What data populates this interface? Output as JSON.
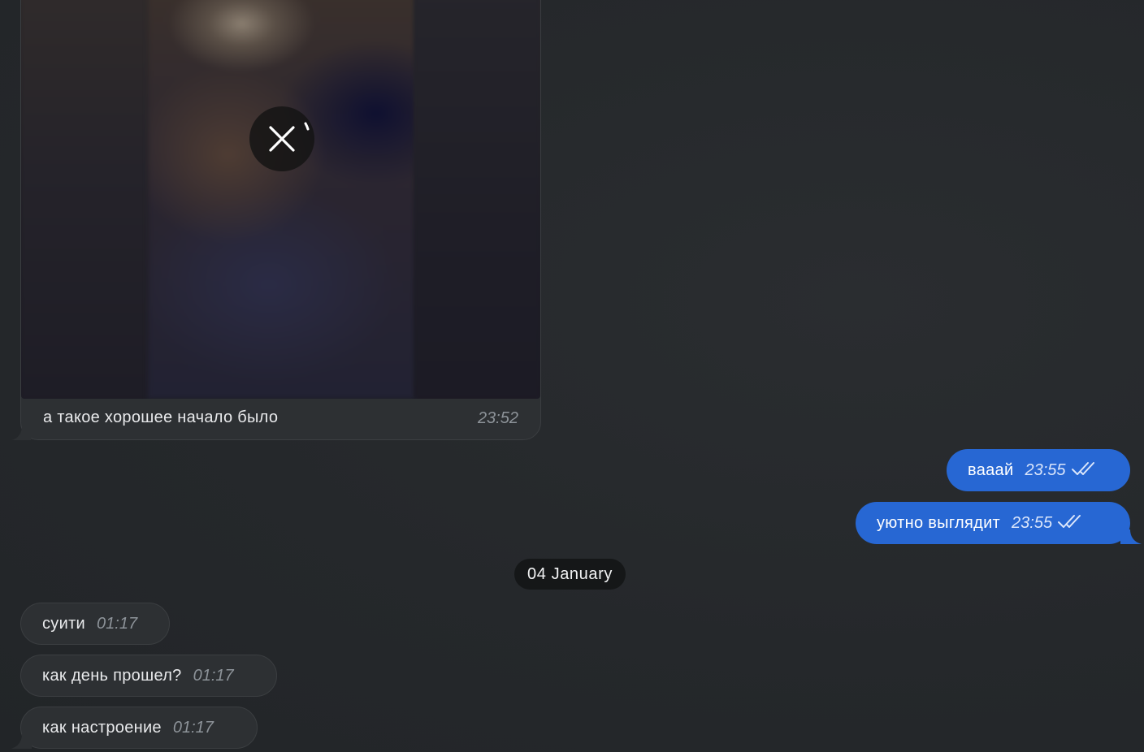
{
  "media_message": {
    "caption": "а такое хорошее начало было",
    "time": "23:52",
    "cancel_icon": "close-icon"
  },
  "outgoing": [
    {
      "text": "вааай",
      "time": "23:55",
      "status_icon": "double-check-icon"
    },
    {
      "text": "уютно выглядит",
      "time": "23:55",
      "status_icon": "double-check-icon"
    }
  ],
  "date_separator": "04 January",
  "incoming": [
    {
      "text": "суити",
      "time": "01:17"
    },
    {
      "text": "как день прошел?",
      "time": "01:17"
    },
    {
      "text": "как настроение",
      "time": "01:17"
    }
  ],
  "colors": {
    "background": "#25282b",
    "incoming_bubble": "#2d3033",
    "outgoing_bubble": "#2767d3",
    "date_pill": "#151718"
  }
}
